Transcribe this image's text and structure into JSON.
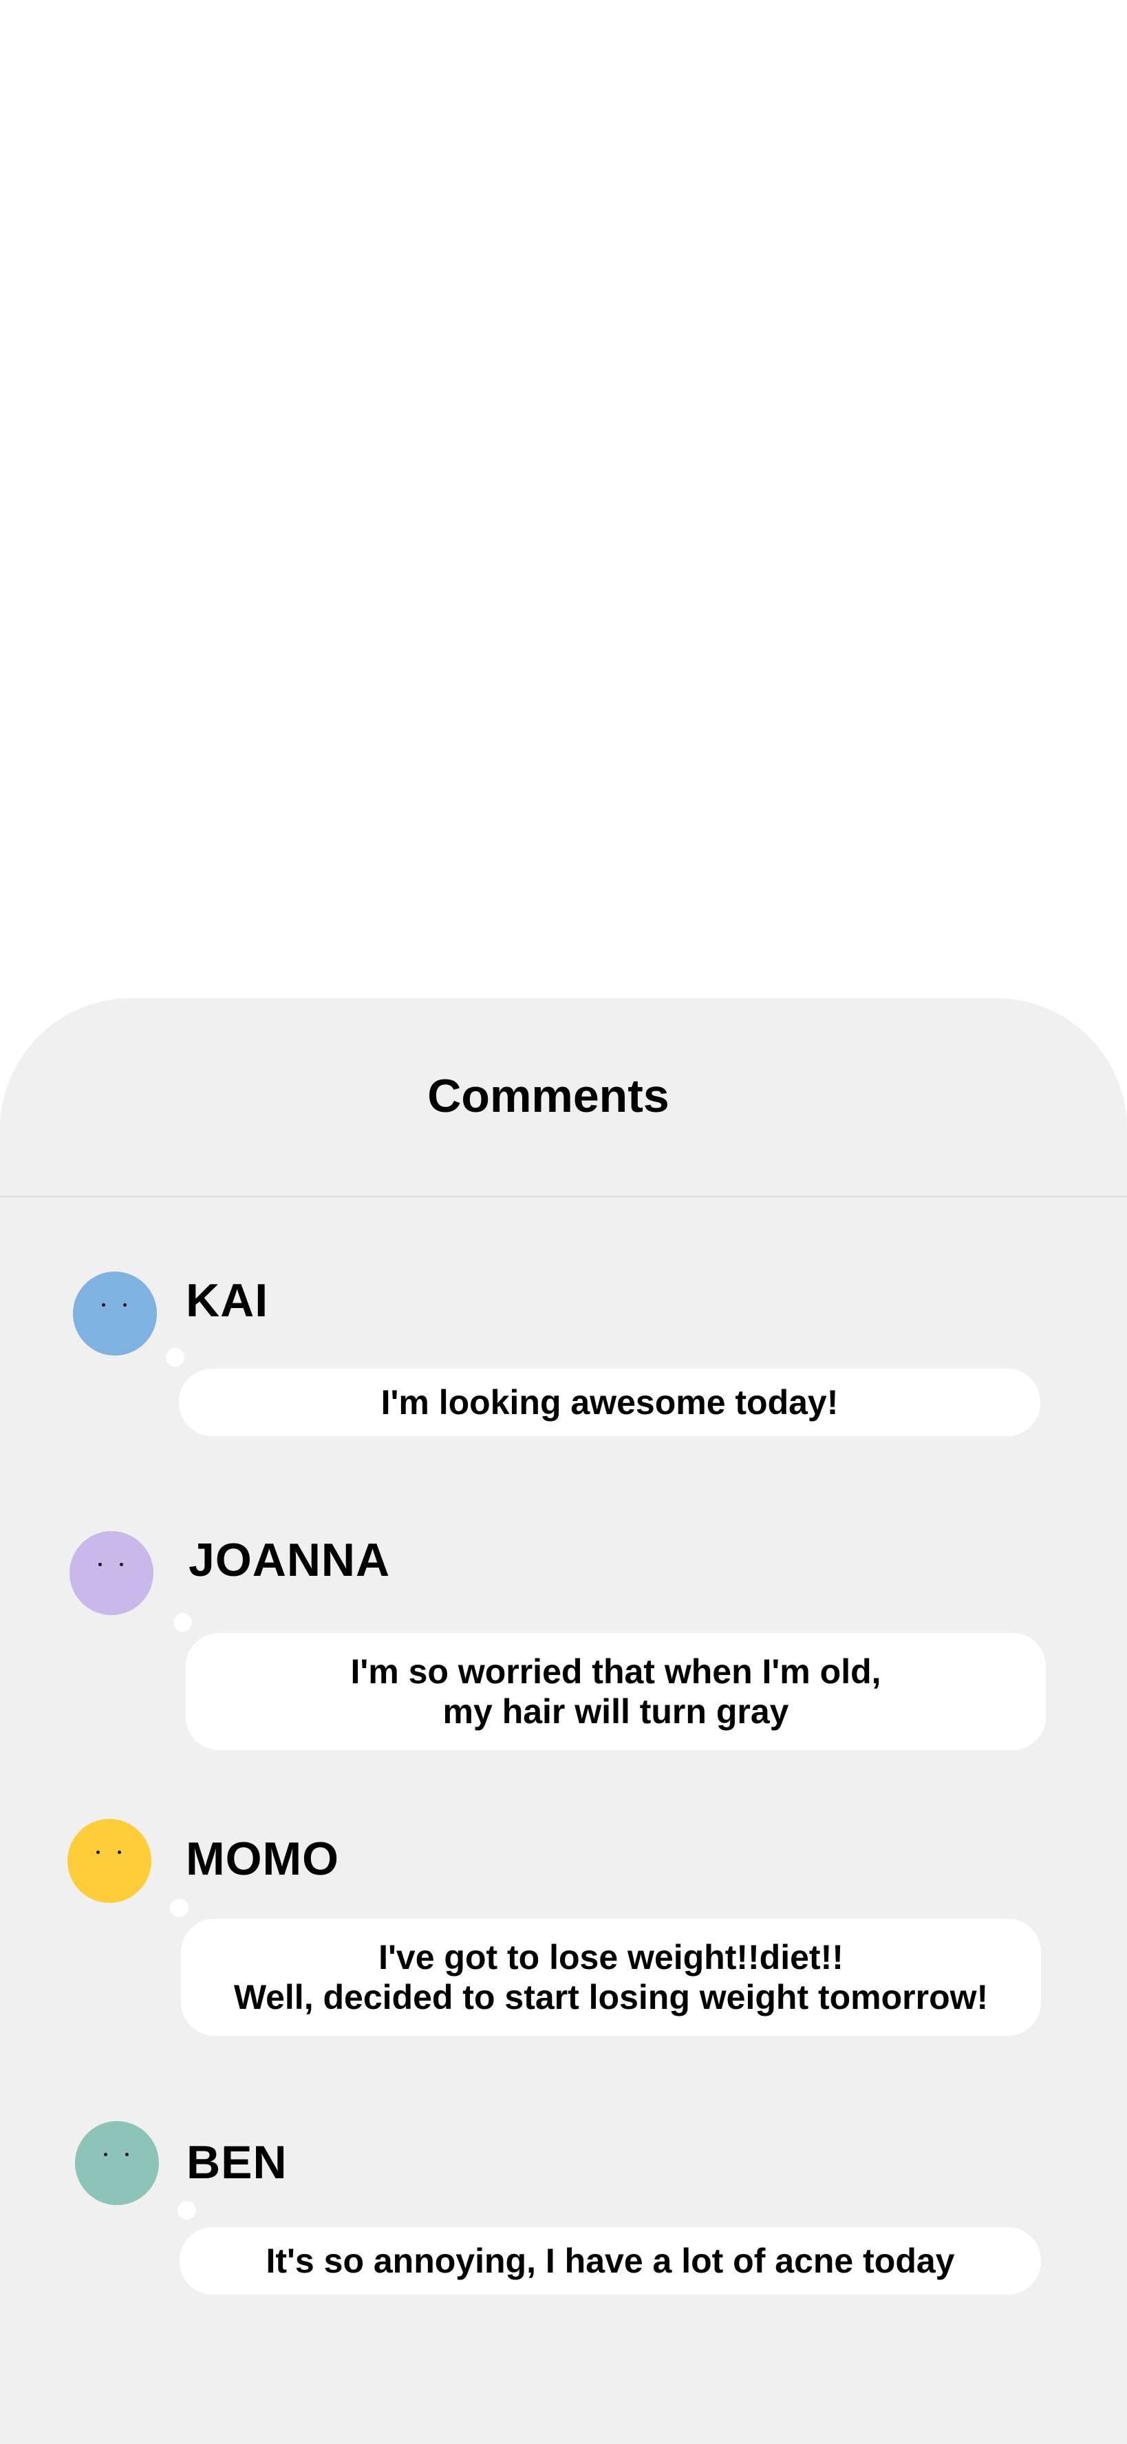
{
  "sheet": {
    "title": "Comments"
  },
  "comments": [
    {
      "name": "KAI",
      "text": "I'm looking awesome today!",
      "avatar_color": "#7fb2e0"
    },
    {
      "name": "JOANNA",
      "text": "I'm so worried that when I'm old,\nmy hair will turn gray",
      "avatar_color": "#c9b8ea"
    },
    {
      "name": "MOMO",
      "text": "I've got to lose weight!!diet!!\nWell, decided to start losing weight tomorrow!",
      "avatar_color": "#fdcd3a"
    },
    {
      "name": "BEN",
      "text": "It's so annoying, I have a lot of acne today",
      "avatar_color": "#8cc4b7"
    }
  ],
  "colors": {
    "sheet_background": "#f0f0f0",
    "page_background": "#ffffff",
    "bubble": "#ffffff",
    "text": "#000000",
    "divider": "#dcdcdc"
  },
  "icons": {
    "avatar": "avatar-face-icon"
  }
}
